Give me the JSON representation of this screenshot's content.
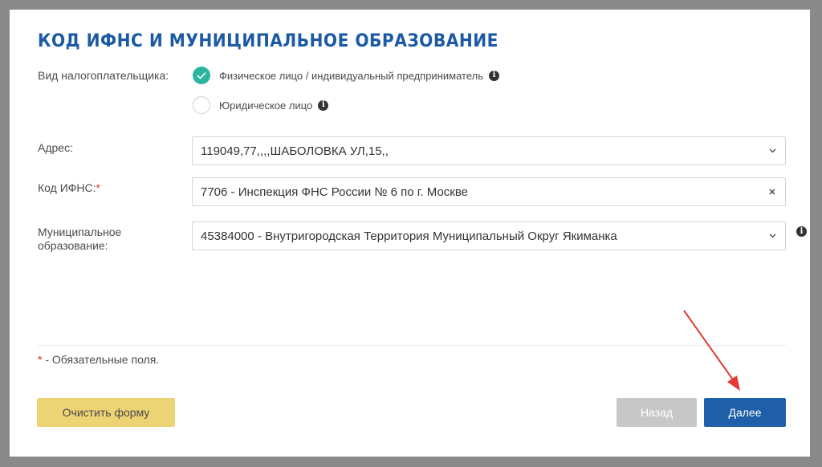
{
  "form": {
    "title": "КОД ИФНС И МУНИЦИПАЛЬНОЕ ОБРАЗОВАНИЕ",
    "taxpayer_type": {
      "label": "Вид налогоплательщика:",
      "options": [
        {
          "label": "Физическое лицо / индивидуальный предприниматель",
          "checked": true
        },
        {
          "label": "Юридическое лицо",
          "checked": false
        }
      ]
    },
    "address": {
      "label": "Адрес:",
      "value": "119049,77,,,,ШАБОЛОВКА УЛ,15,,"
    },
    "ifns": {
      "label": "Код ИФНС:",
      "required_mark": "*",
      "value": "7706 - Инспекция ФНС России № 6 по г. Москве"
    },
    "municipality": {
      "label_line1": "Муниципальное",
      "label_line2": "образование:",
      "value": "45384000 - Внутригородская Территория Муниципальный Округ Якиманка"
    },
    "required_note": {
      "star": "*",
      "text": " - Обязательные поля."
    }
  },
  "buttons": {
    "clear": "Очистить форму",
    "back": "Назад",
    "next": "Далее"
  },
  "colors": {
    "title": "#1c5aa5",
    "radio_checked": "#2bb5a0",
    "clear_button": "#ecd373",
    "back_button": "#c8c8c8",
    "next_button": "#1f5fa8",
    "annotation_arrow": "#e53935"
  },
  "icons": {
    "check": "check-icon",
    "info": "info-icon",
    "dropdown": "chevron-down-icon",
    "clear": "close-icon"
  }
}
